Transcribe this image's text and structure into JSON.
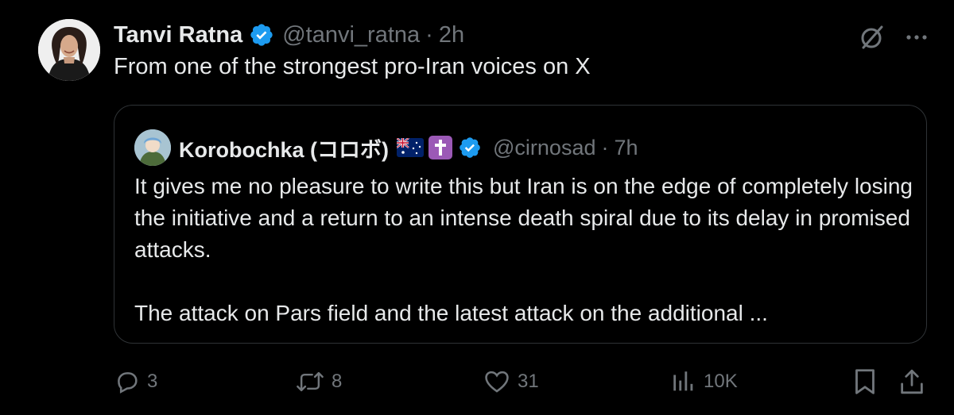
{
  "tweet": {
    "author": {
      "display_name": "Tanvi Ratna",
      "handle": "@tanvi_ratna",
      "separator": "·",
      "time": "2h",
      "verified": true
    },
    "text": "From one of the strongest pro-Iran voices on X",
    "quoted": {
      "display_name": "Korobochka (コロボ)",
      "handle": "@cirnosad",
      "separator": "·",
      "time": "7h",
      "badges": [
        "australia-flag-icon",
        "latin-cross-icon",
        "verified-icon"
      ],
      "paragraphs": [
        "It gives me no pleasure to write this but Iran is on the edge of completely losing the initiative and a return to an intense death spiral due to its delay in promised attacks.",
        "The attack on Pars field and the latest attack on the additional ..."
      ]
    },
    "actions": {
      "reply": {
        "icon": "reply-icon",
        "count": "3"
      },
      "repost": {
        "icon": "repost-icon",
        "count": "8"
      },
      "like": {
        "icon": "heart-icon",
        "count": "31"
      },
      "views": {
        "icon": "views-icon",
        "count": "10K"
      },
      "bookmark": {
        "icon": "bookmark-icon"
      },
      "share": {
        "icon": "share-icon"
      }
    },
    "top_icons": [
      "grok-icon",
      "more-icon"
    ]
  },
  "colors": {
    "background": "#000000",
    "text": "#e7e9ea",
    "muted": "#71767b",
    "border": "#2f3336",
    "verified": "#1d9bf0"
  }
}
